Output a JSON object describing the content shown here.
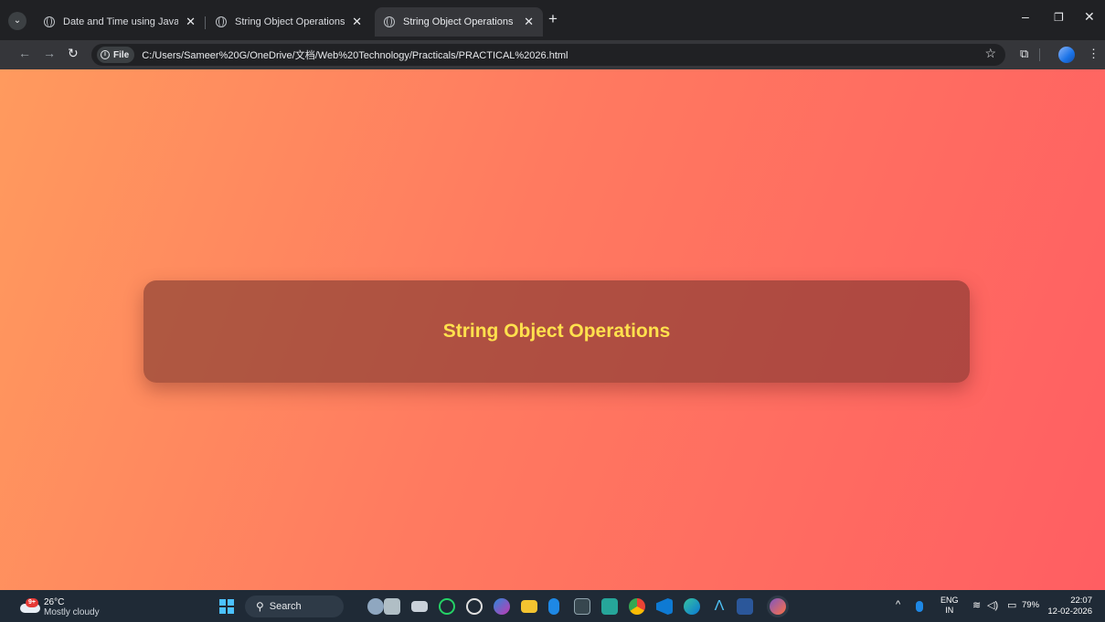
{
  "browser": {
    "tabs": [
      {
        "title": "Date and Time using JavaScript",
        "active": false
      },
      {
        "title": "String Object Operations",
        "active": false
      },
      {
        "title": "String Object Operations",
        "active": true
      }
    ],
    "address": {
      "chip_label": "File",
      "url": "C:/Users/Sameer%20G/OneDrive/文档/Web%20Technology/Practicals/PRACTICAL%2026.html"
    }
  },
  "page": {
    "heading": "String Object Operations",
    "colors": {
      "gradient_start": "#ff9a5e",
      "gradient_end": "#ff5e62",
      "heading": "#ffe14d"
    }
  },
  "taskbar": {
    "weather": {
      "temp": "26°C",
      "desc": "Mostly cloudy",
      "badge": "9+"
    },
    "search_label": "Search",
    "lang_primary": "ENG",
    "lang_secondary": "IN",
    "battery": "79%",
    "time": "22:07",
    "date": "12-02-2026"
  }
}
